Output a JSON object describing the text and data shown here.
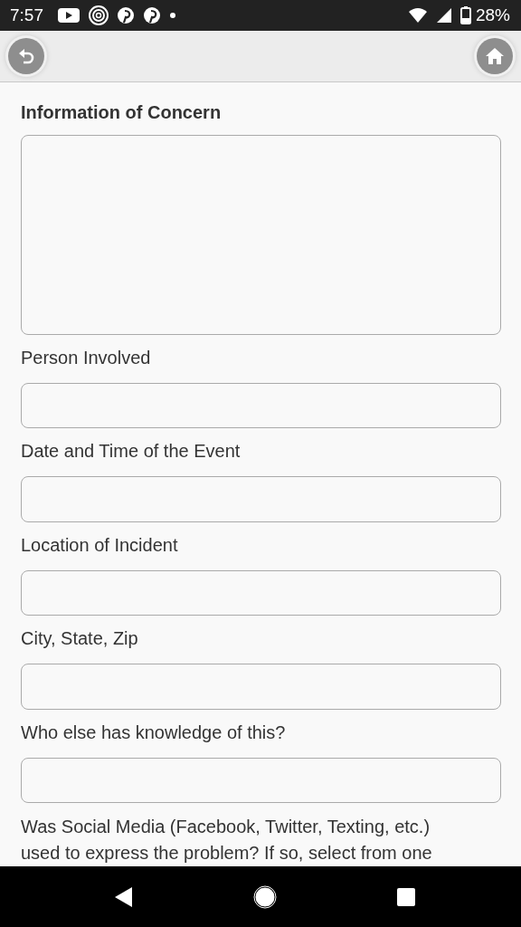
{
  "status_bar": {
    "time": "7:57",
    "battery": "28%"
  },
  "form": {
    "title": "Information of Concern",
    "fields": [
      {
        "kind": "textarea"
      },
      {
        "kind": "input",
        "label": "Person Involved"
      },
      {
        "kind": "input",
        "label": "Date and Time of the Event"
      },
      {
        "kind": "input",
        "label": "Location of Incident"
      },
      {
        "kind": "input",
        "label": "City, State, Zip"
      },
      {
        "kind": "input",
        "label": "Who else has knowledge of this?"
      }
    ],
    "question": "Was Social Media (Facebook, Twitter, Texting, etc.) used to express the problem? If so, select from one"
  }
}
